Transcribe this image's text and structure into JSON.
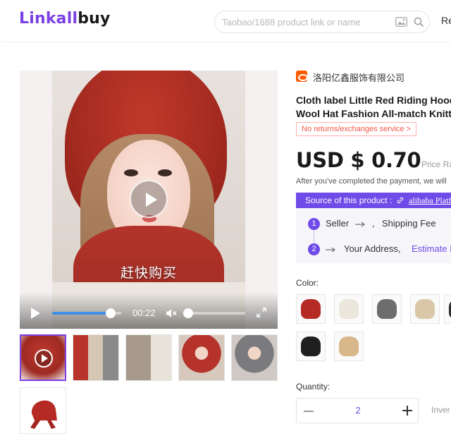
{
  "header": {
    "logo_part1": "Linkall",
    "logo_part2": "buy",
    "search_placeholder": "Taobao/1688 product link or name",
    "right_text": "Re"
  },
  "gallery": {
    "caption": "赶快购买",
    "video_time": "00:22",
    "video_progress": 0.85,
    "volume_level": 0.0,
    "thumb_count": 6
  },
  "product": {
    "seller_name": "洛阳亿鑫服饰有限公司",
    "title_line1": "Cloth label Little Red Riding Hood A",
    "title_line2": "Wool Hat Fashion All-match Knitte",
    "no_return_badge": "No returns/exchanges service >",
    "price": "USD $ 0.70",
    "price_rate_label": "Price Ra",
    "payment_note": "After you've completed the payment, we will",
    "source_label": "Source of this product :",
    "source_link": "alibaba Platform",
    "flow": {
      "step1_num": "1",
      "step1_a": "Seller",
      "step1_sep": ",",
      "step1_b": "Shipping Fee",
      "step2_num": "2",
      "step2_a": "Your Address,",
      "step2_b": "Estimate I"
    },
    "color_label": "Color:",
    "colors": [
      "#b52a24",
      "#ece7dc",
      "#6d6d6d",
      "#d9c7a8",
      "#2b2b2b",
      "#1f1f1f",
      "#d8b88a"
    ],
    "quantity_label": "Quantity:",
    "quantity_value": "2",
    "inventory_label": "Inver"
  }
}
